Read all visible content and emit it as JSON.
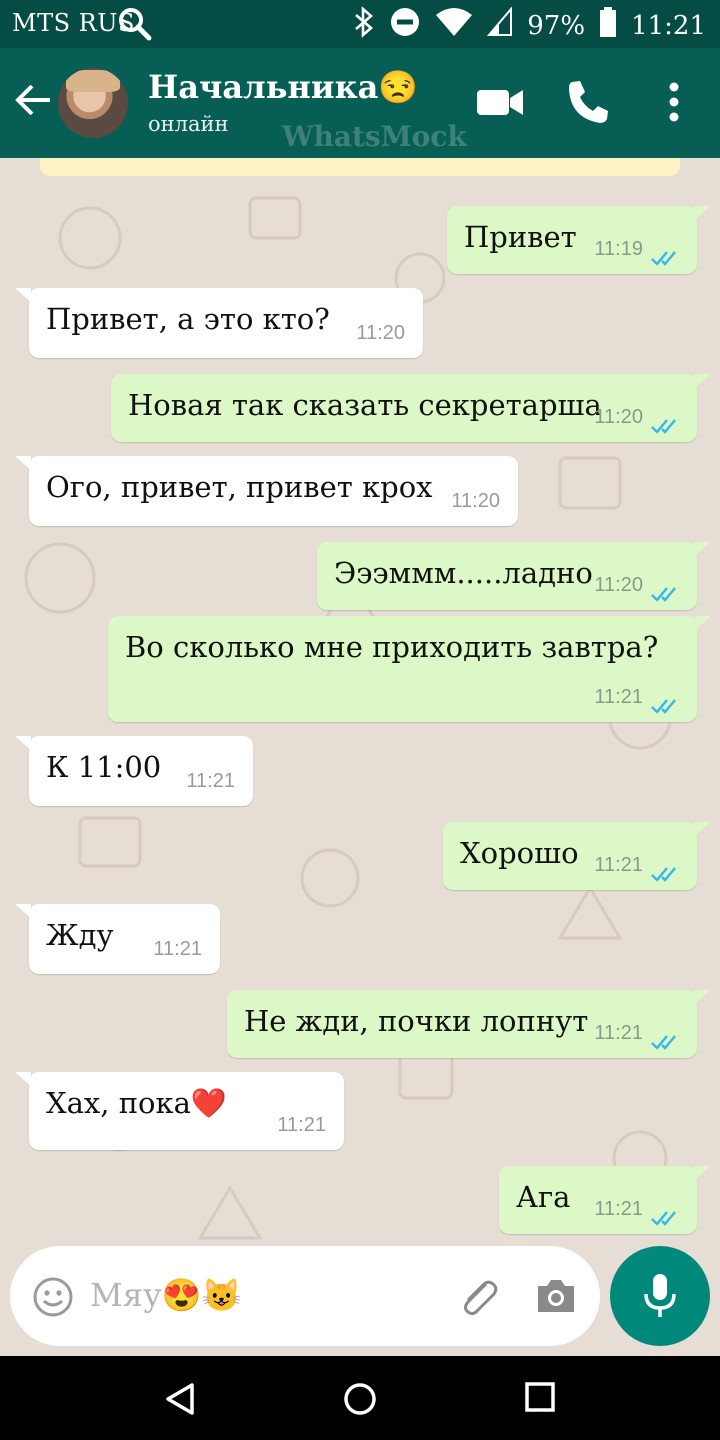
{
  "status_bar": {
    "carrier": "MTS RUS",
    "battery": "97%",
    "time": "11:21"
  },
  "header": {
    "contact_name": "Начальника😒",
    "status": "онлайн",
    "watermark": "WhatsMock"
  },
  "messages": [
    {
      "direction": "out",
      "text": "Привет",
      "time": "11:19",
      "read": true
    },
    {
      "direction": "in",
      "text": "Привет, а это кто?",
      "time": "11:20"
    },
    {
      "direction": "out",
      "text": "Новая так сказать секретарша",
      "time": "11:20",
      "read": true
    },
    {
      "direction": "in",
      "text": "Ого, привет, привет крох",
      "time": "11:20"
    },
    {
      "direction": "out",
      "text": "Эээммм.....ладно",
      "time": "11:20",
      "read": true
    },
    {
      "direction": "out",
      "text": "Во сколько мне приходить завтра?",
      "time": "11:21",
      "read": true
    },
    {
      "direction": "in",
      "text": "К 11:00",
      "time": "11:21"
    },
    {
      "direction": "out",
      "text": "Хорошо",
      "time": "11:21",
      "read": true
    },
    {
      "direction": "in",
      "text": "Жду",
      "time": "11:21"
    },
    {
      "direction": "out",
      "text": "Не жди, почки лопнут",
      "time": "11:21",
      "read": true
    },
    {
      "direction": "in",
      "text": "Хах, пока❤️",
      "time": "11:21"
    },
    {
      "direction": "out",
      "text": "Ага",
      "time": "11:21",
      "read": true
    }
  ],
  "composer": {
    "text": "Мяу😍😺"
  },
  "colors": {
    "header": "#075e54",
    "status_bar": "#054d44",
    "out_bubble": "#dcf8c6",
    "in_bubble": "#ffffff",
    "chat_bg": "#e6ddd4",
    "read_ticks": "#34b7f1",
    "fab": "#00897b"
  },
  "icons": [
    "search-icon",
    "bluetooth-icon",
    "dnd-icon",
    "wifi-icon",
    "signal-icon",
    "battery-icon",
    "back-arrow-icon",
    "video-call-icon",
    "phone-icon",
    "more-vert-icon",
    "emoji-icon",
    "attach-icon",
    "camera-icon",
    "mic-icon",
    "nav-back-icon",
    "nav-home-icon",
    "nav-recents-icon"
  ]
}
